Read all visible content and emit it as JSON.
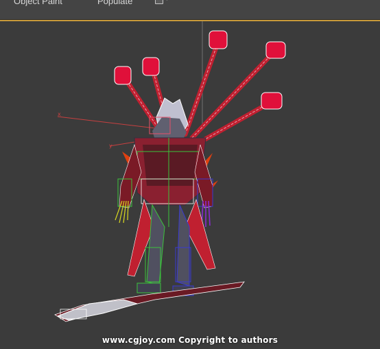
{
  "ribbon": {
    "tabs": [
      "Object Paint",
      "Populate"
    ],
    "options_icon": "ribbon-options-icon"
  },
  "viewport": {
    "axis_x_label": "x",
    "axis_y_label": "y",
    "watermark": "www.cgjoy.com Copyright to authors"
  },
  "colors": {
    "viewport_bg": "#3b3b3b",
    "ribbon_bg": "#444444",
    "active_viewport_border": "#c89a3a",
    "bone_pink": "#e8506a",
    "bone_green": "#3bc43b",
    "bone_yellow": "#d8d820",
    "bone_blue": "#3a3ad0",
    "bone_purple": "#8a2ad0",
    "orb_red": "#e0103a"
  }
}
